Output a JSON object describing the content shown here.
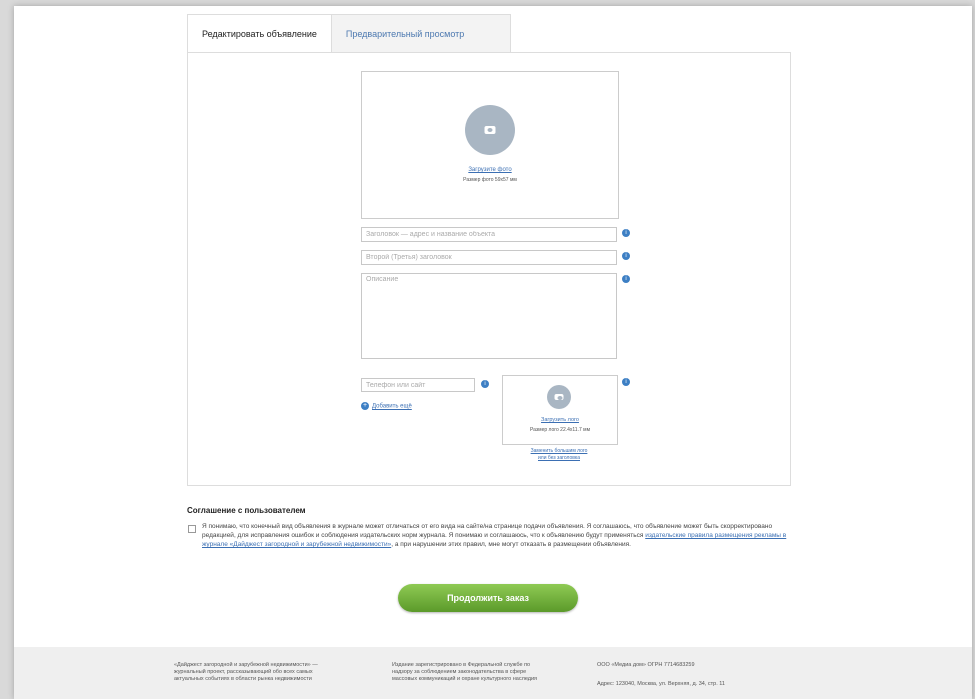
{
  "tabs": {
    "edit": "Редактировать объявление",
    "preview": "Предварительный просмотр"
  },
  "photo": {
    "upload_link": "Загрузите фото",
    "size_note": "Размер фото 59x57 мм"
  },
  "fields": {
    "title_placeholder": "Заголовок — адрес и название объекта",
    "subtitle_placeholder": "Второй (Третья) заголовок",
    "description_placeholder": "Описание",
    "phone_placeholder": "Телефон или сайт"
  },
  "add_phone": "Добавить ещё",
  "logo": {
    "upload_link": "Загрузить лого",
    "size_note": "Размер лого 22.4x11.7 мм",
    "alt_link": "Заменить большим лого",
    "alt_link2": "или без заголовка"
  },
  "agreement": {
    "title": "Соглашение с пользователем",
    "text_part1": "Я понимаю, что конечный вид объявления в журнале может отличаться от его вида на сайте/на странице подачи объявления. Я соглашаюсь, что объявление может быть скорректировано редакцией, для исправления ошибок и соблюдения издательских норм журнала. Я понимаю и соглашаюсь, что к объявлению будут применяться",
    "link_text": "издательские правила размещения рекламы в журнале «Дайджест загородной и зарубежной недвижимости»",
    "text_part2": ", а при нарушении этих правил, мне могут отказать в размещении объявления."
  },
  "continue_button": "Продолжить заказ",
  "footer": {
    "col1": "«Дайджест загородной и зарубежной недвижимости» — журнальный проект, рассказывающий обо всех самых актуальных событиях в области рынка недвижимости",
    "col2": "Издание зарегистрировано в Федеральной службе по надзору за соблюдением законодательства в сфере массовых коммуникаций и охране культурного наследия",
    "col3a": "ООО «Медиа дом» ОГРН 7714683259",
    "col3b": "Адрес: 123040, Москва, ул. Верхняя, д. 34, стр. 11"
  }
}
